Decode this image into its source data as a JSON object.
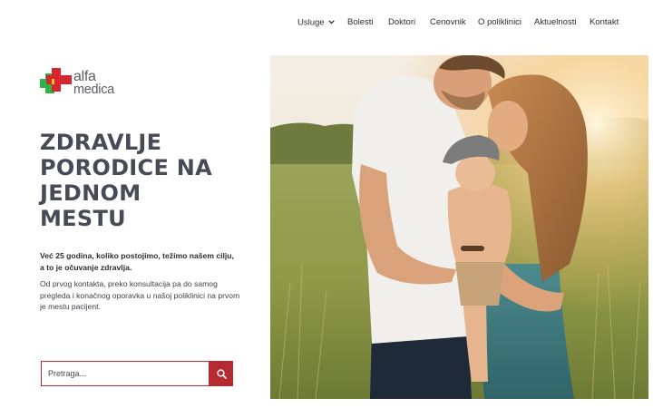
{
  "nav": {
    "items": [
      {
        "label": "Usluge",
        "has_dropdown": true
      },
      {
        "label": "Bolesti"
      },
      {
        "label": "Doktori"
      },
      {
        "label": "Cenovnik"
      },
      {
        "label": "O poliklinici"
      },
      {
        "label": "Aktuelnosti"
      },
      {
        "label": "Kontakt"
      }
    ]
  },
  "logo": {
    "line1": "alfa",
    "line2": "medica",
    "colors": {
      "green": "#2db34a",
      "red": "#d7262e",
      "text": "#5b5d63"
    }
  },
  "hero": {
    "headline_lines": [
      "ZDRAVLJE",
      "PORODICE NA",
      "JEDNOM",
      "MESTU"
    ],
    "lead": "Već 25 godina, koliko postojimo, težimo našem cilju, a to je očuvanje zdravlja.",
    "body": "Od prvog kontakta, preko konsultacija pa do samog pregleda i konačnog oporavka u našoj poliklinici na prvom je mestu pacijent."
  },
  "search": {
    "placeholder": "Pretraga...",
    "button_icon": "search-icon",
    "accent": "#b42a31"
  },
  "image": {
    "subject": "family-photo"
  }
}
